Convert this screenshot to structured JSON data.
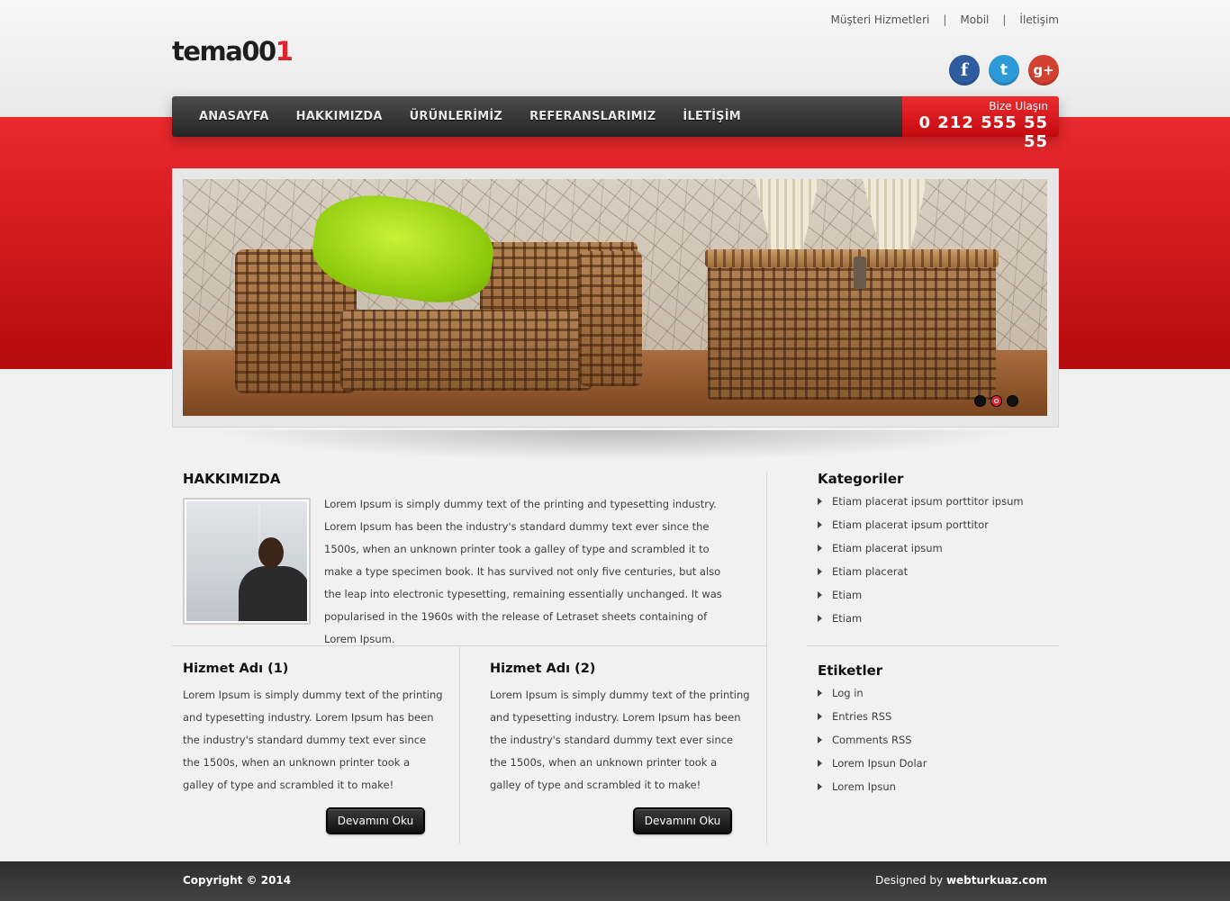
{
  "top_links": [
    "Müşteri Hizmetleri",
    "Mobil",
    "İletişim"
  ],
  "top_links_separator": "|",
  "logo": {
    "text": "tema00",
    "accent": "1",
    "accent_color": "#e0232a"
  },
  "social": {
    "facebook": "f",
    "twitter": "t",
    "googleplus": "g+"
  },
  "nav": [
    "ANASAYFA",
    "HAKKIMIZDA",
    "ÜRÜNLERİMİZ",
    "REFERANSLARIMIZ",
    "İLETİŞİM"
  ],
  "contact": {
    "label": "Bize Ulaşın",
    "phone": "0 212 555 55 55"
  },
  "slider": {
    "dots": 3,
    "active_dot": 2
  },
  "about": {
    "title": "HAKKIMIZDA",
    "text": "Lorem Ipsum is simply dummy text of the printing and typesetting industry. Lorem Ipsum has been the industry's standard dummy text ever since the 1500s, when an unknown printer took a galley of type and scrambled it to make a type specimen book. It has survived not only five centuries, but also the leap into electronic typesetting, remaining essentially unchanged. It was popularised in the 1960s with the release of Letraset sheets containing of Lorem Ipsum."
  },
  "services": [
    {
      "title": "Hizmet Adı (1)",
      "text": "Lorem Ipsum is simply dummy text of the printing and typesetting industry. Lorem Ipsum has been the industry's standard dummy text ever since the 1500s, when an unknown printer took a galley of type and scrambled it to make!",
      "button": "Devamını Oku"
    },
    {
      "title": "Hizmet Adı (2)",
      "text": "Lorem Ipsum is simply dummy text of the printing and typesetting industry. Lorem Ipsum has been the industry's standard dummy text ever since the 1500s, when an unknown printer took a galley of type and scrambled it to make!",
      "button": "Devamını Oku"
    }
  ],
  "categories": {
    "title": "Kategoriler",
    "items": [
      "Etiam placerat ipsum porttitor ipsum",
      "Etiam placerat ipsum porttitor",
      "Etiam placerat ipsum",
      "Etiam placerat",
      "Etiam",
      "Etiam"
    ]
  },
  "tags": {
    "title": "Etiketler",
    "items": [
      "Log in",
      "Entries RSS",
      "Comments RSS",
      "Lorem Ipsun Dolar",
      "Lorem Ipsun"
    ]
  },
  "footer": {
    "copyright": "Copyright © 2014",
    "designed_prefix": "Designed by ",
    "designed_by": "webturkuaz.com"
  },
  "colors": {
    "accent": "#e0232a",
    "nav_dark": "#2b2b2b",
    "facebook": "#2f5c9f",
    "twitter": "#2c9ad7",
    "googleplus": "#d2402f"
  }
}
